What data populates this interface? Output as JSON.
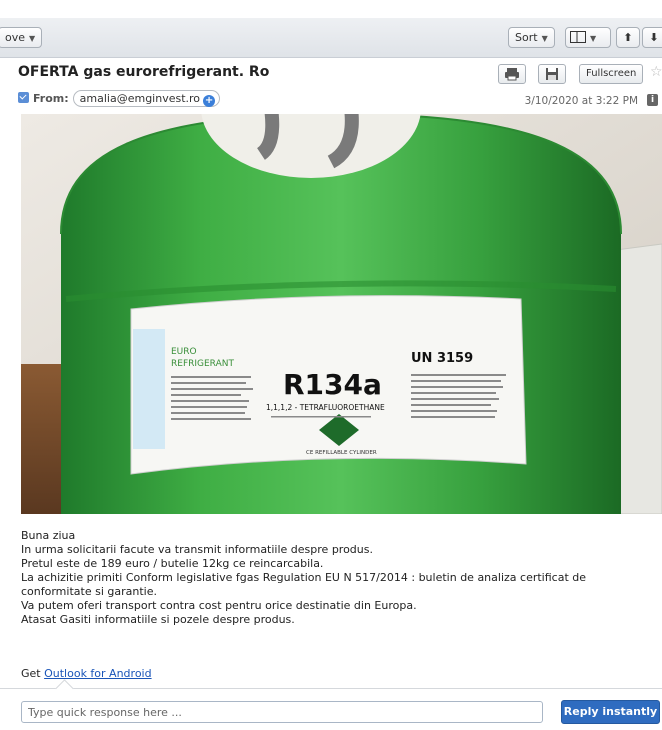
{
  "toolbar": {
    "move_label": "ove",
    "sort_label": "Sort",
    "up_arrow": "⬆",
    "down_arrow": "⬇"
  },
  "header": {
    "subject": "OFERTA gas eurorefrigerant. Ro",
    "from_label": "From:",
    "from_email": "amalia@emginvest.ro",
    "date": "3/10/2020 at 3:22 PM",
    "fullscreen_label": "Fullscreen"
  },
  "photo": {
    "label_brand_top": "EURO",
    "label_brand_bottom": "REFRIGERANT",
    "gas_name": "R134a",
    "gas_desc": "1,1,1,2 - TETRAFLUOROETHANE",
    "un_number": "UN 3159",
    "cylinder_text": "CE REFILLABLE CYLINDER"
  },
  "body": {
    "lines": [
      "Buna ziua",
      "In urma solicitarii facute va transmit informatiile despre produs.",
      "Pretul este de 189 euro / butelie 12kg ce reincarcabila.",
      "La achizitie primiti Conform legislative fgas Regulation EU N 517/2014 : buletin de analiza certificat de conformitate si garantie.",
      "Va putem oferi transport contra cost pentru orice destinatie din Europa.",
      "Atasat Gasiti informatiile si pozele despre produs."
    ],
    "signature_prefix": "Get ",
    "signature_link": "Outlook for Android"
  },
  "reply": {
    "placeholder": "Type quick response here ...",
    "button_label": "Reply instantly"
  },
  "colors": {
    "accent": "#2f6cc0",
    "cylinder_green": "#3aa83f"
  }
}
